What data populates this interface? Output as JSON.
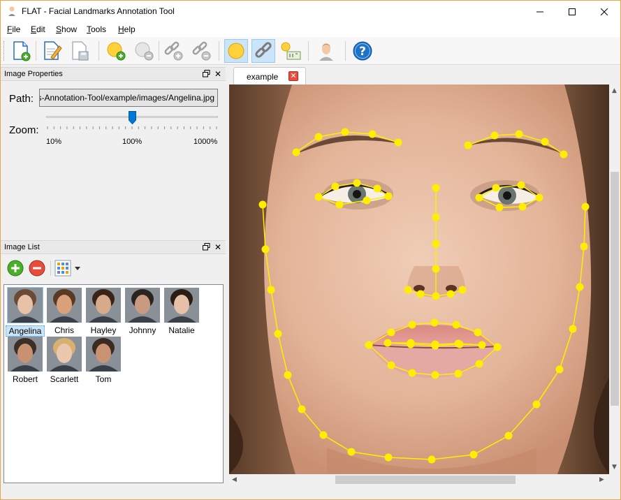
{
  "window": {
    "title": "FLAT - Facial Landmarks Annotation Tool",
    "controls": [
      "minimize",
      "maximize",
      "close"
    ]
  },
  "menu": {
    "items": [
      "File",
      "Edit",
      "Show",
      "Tools",
      "Help"
    ]
  },
  "toolbar": {
    "buttons": [
      {
        "icon": "new-file-icon"
      },
      {
        "icon": "edit-file-icon"
      },
      {
        "icon": "save-file-icon"
      },
      {
        "icon": "add-landmark-icon"
      },
      {
        "icon": "remove-landmark-icon"
      },
      {
        "icon": "add-link-icon"
      },
      {
        "icon": "remove-link-icon"
      },
      {
        "icon": "show-landmarks-icon",
        "active": true
      },
      {
        "icon": "show-links-icon",
        "active": true
      },
      {
        "icon": "show-ids-icon"
      },
      {
        "icon": "fit-face-icon"
      },
      {
        "icon": "help-icon"
      }
    ]
  },
  "image_properties": {
    "title": "Image Properties",
    "path_label": "Path:",
    "path_value": "FLAT-Facial-Landmarks-Annotation-Tool/example/images/Angelina.jpg",
    "zoom_label": "Zoom:",
    "zoom_value_percent": 100,
    "zoom_min_label": "10%",
    "zoom_mid_label": "100%",
    "zoom_max_label": "1000%"
  },
  "image_list": {
    "title": "Image List",
    "items": [
      {
        "name": "Angelina",
        "selected": true,
        "hair": "#6b4a35",
        "skin": "#e8c2a8"
      },
      {
        "name": "Chris",
        "selected": false,
        "hair": "#5a3a22",
        "skin": "#d9a07a"
      },
      {
        "name": "Hayley",
        "selected": false,
        "hair": "#3a2418",
        "skin": "#d8aa8c"
      },
      {
        "name": "Johnny",
        "selected": false,
        "hair": "#2a2420",
        "skin": "#c89a80"
      },
      {
        "name": "Natalie",
        "selected": false,
        "hair": "#2b1c14",
        "skin": "#e6c0a8"
      },
      {
        "name": "Robert",
        "selected": false,
        "hair": "#3a3028",
        "skin": "#c89272"
      },
      {
        "name": "Scarlett",
        "selected": false,
        "hair": "#d8b070",
        "skin": "#eac8b0"
      },
      {
        "name": "Tom",
        "selected": false,
        "hair": "#3a2a20",
        "skin": "#c99272"
      }
    ]
  },
  "document": {
    "tab_label": "example"
  },
  "colors": {
    "landmark": "#ffee00",
    "selection": "#cce4f7",
    "accent": "#0078d7"
  }
}
